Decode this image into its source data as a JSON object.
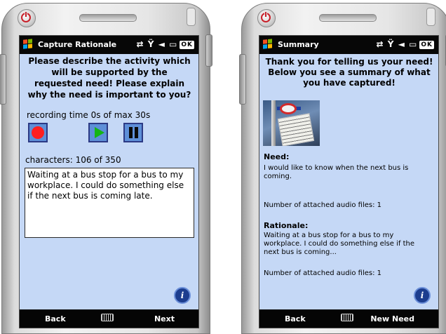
{
  "left": {
    "title": "Capture Rationale",
    "status_icons": "⇄ Ÿ ◄ ▭",
    "ok": "OK",
    "heading": "Please describe the activity which will be supported by the requested need! Please explain why the need is important to you?",
    "recording_label": "recording time 0s of max 30s",
    "chars_label": "characters: 106 of 350",
    "text_value": "Waiting at a bus stop for a bus to my workplace. I could do something else if the next bus is coming late.",
    "info": "i",
    "soft_left": "Back",
    "soft_right": "Next"
  },
  "right": {
    "title": "Summary",
    "status_icons": "⇄ Ÿ ◄ ▭",
    "ok": "OK",
    "heading": "Thank you for telling us your need! Below you see a summary of what you have captured!",
    "need_label": "Need:",
    "need_text": "I would like to know when the next bus is coming.",
    "need_audio": "Number of attached audio files: 1",
    "rationale_label": "Rationale:",
    "rationale_text": "Waiting at a bus stop for a bus to my workplace. I could do something else if the next bus is coming...",
    "rationale_audio": "Number of attached audio files: 1",
    "info": "i",
    "soft_left": "Back",
    "soft_right": "New Need"
  }
}
